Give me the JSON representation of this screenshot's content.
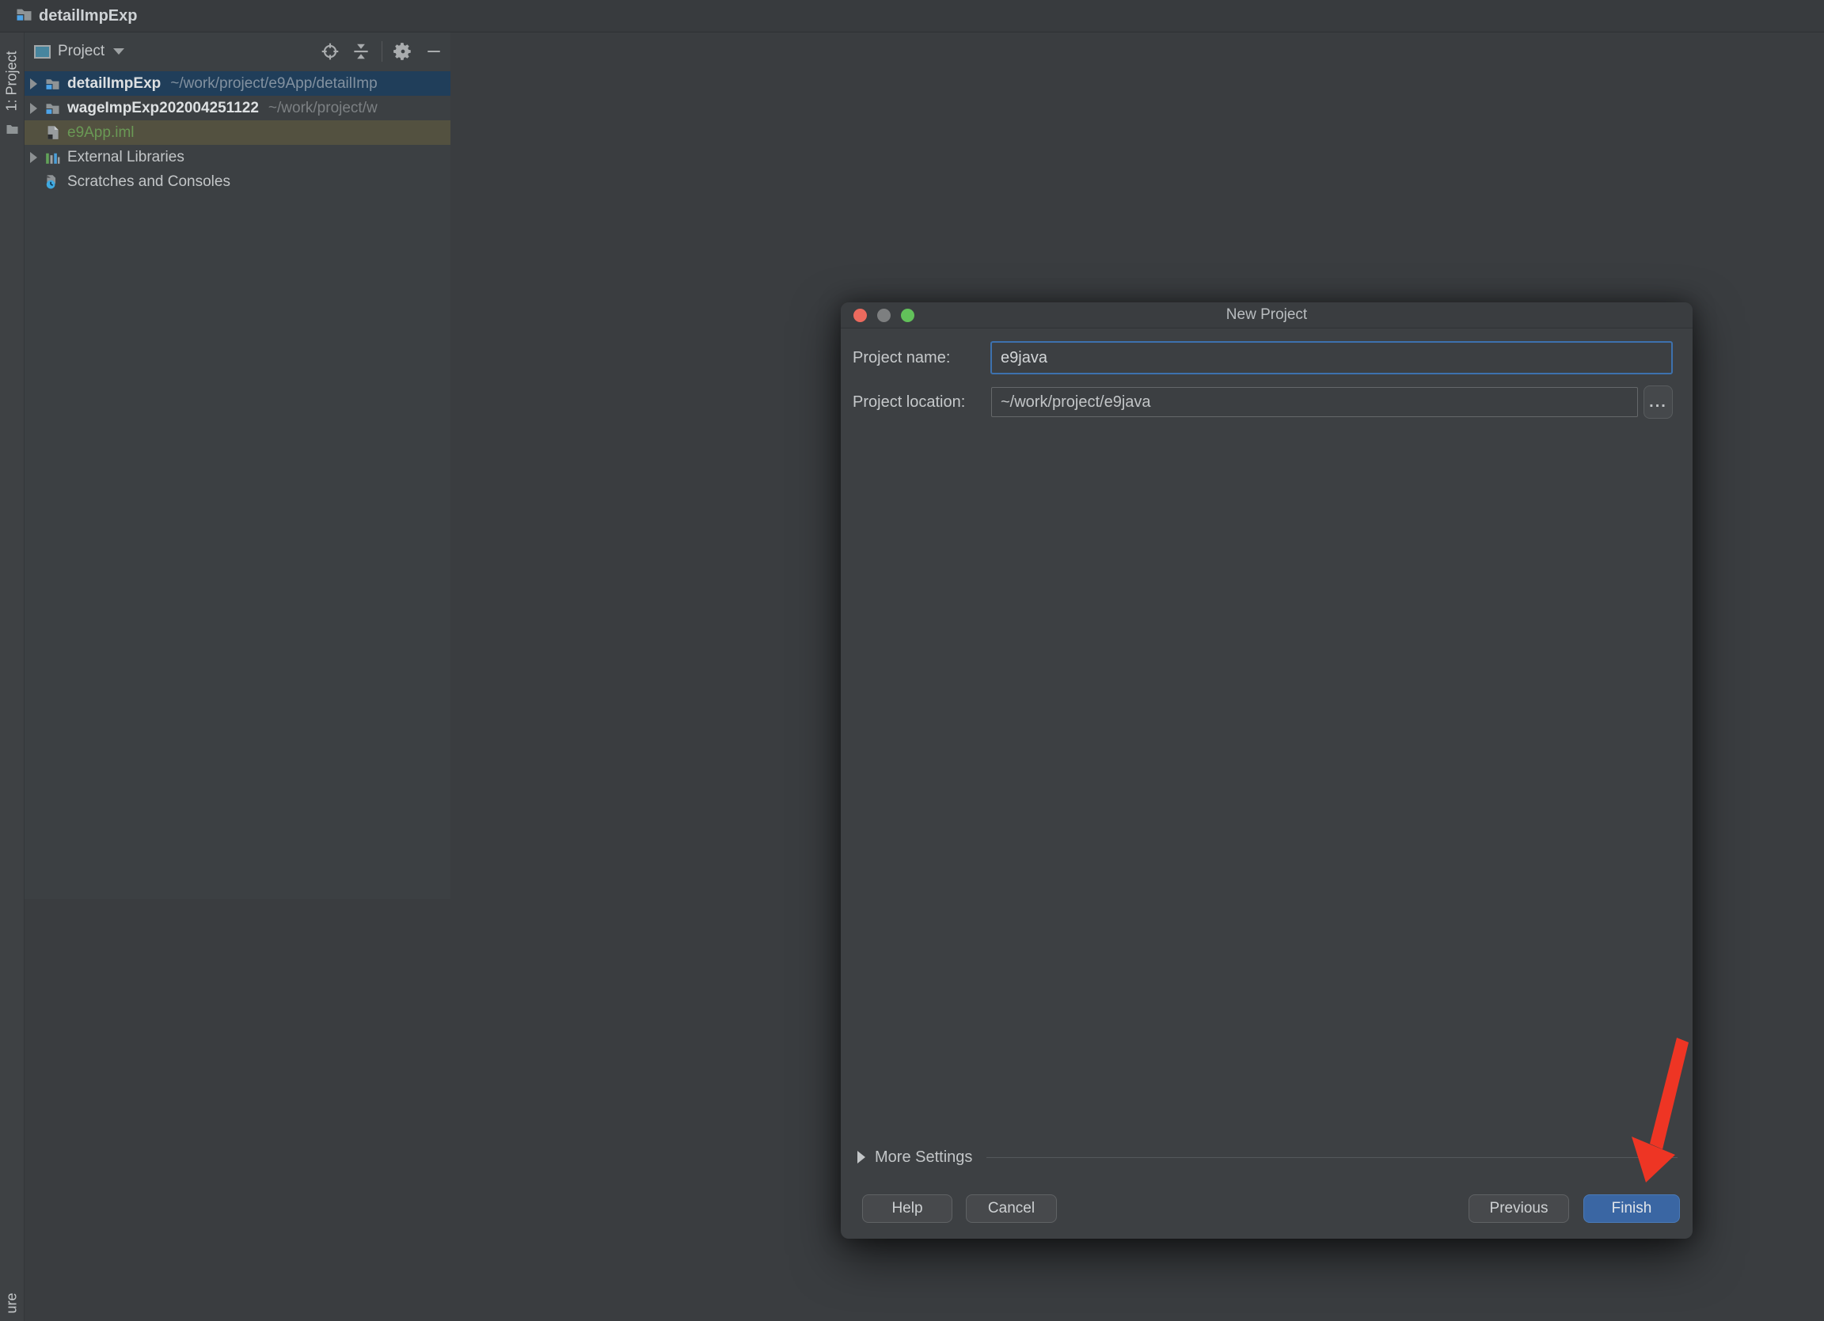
{
  "window": {
    "title": "detailImpExp"
  },
  "tool_stripe": {
    "top_label": "1: Project",
    "bottom_label": "ure"
  },
  "project_panel": {
    "header": {
      "title": "Project",
      "icons": [
        "project-view-square-icon",
        "chevron-down-icon",
        "locate-icon",
        "collapse-all-icon",
        "settings-gear-icon",
        "hide-panel-icon"
      ]
    },
    "tree": [
      {
        "name": "detailImpExp",
        "path": "~/work/project/e9App/detailImp",
        "selected": true,
        "type": "project-folder"
      },
      {
        "name": "wageImpExp202004251122",
        "path": "~/work/project/w",
        "selected": false,
        "type": "project-folder"
      },
      {
        "name": "e9App.iml",
        "type": "module-file",
        "highlighted": true
      },
      {
        "name": "External Libraries",
        "type": "libraries"
      },
      {
        "name": "Scratches and Consoles",
        "type": "scratches"
      }
    ]
  },
  "dialog": {
    "title": "New Project",
    "fields": [
      {
        "label": "Project name:",
        "value": "e9java",
        "focused": true
      },
      {
        "label": "Project location:",
        "value": "~/work/project/e9java",
        "browse": "..."
      }
    ],
    "more_settings": "More Settings",
    "buttons": {
      "help": "Help",
      "cancel": "Cancel",
      "previous": "Previous",
      "finish": "Finish"
    }
  },
  "annotation": {
    "shape": "red-arrow",
    "points_at": "finish-button"
  },
  "colors": {
    "selection_blue": "#203e5a",
    "iml_row_highlight": "#535140",
    "iml_text_green": "#6a9955",
    "focus_border": "#3d71ae",
    "finish_button": "#3a66a3",
    "arrow_red": "#ee3524",
    "traffic_red": "#ec6a5e",
    "traffic_gray": "#7d7f80",
    "traffic_green": "#62c15a"
  }
}
